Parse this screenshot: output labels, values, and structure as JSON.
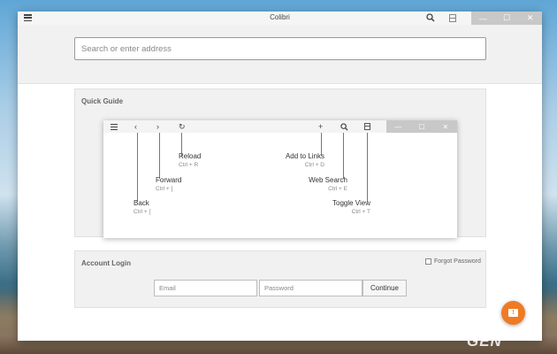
{
  "window": {
    "title": "Colibri",
    "controls": {
      "minimize": "—",
      "maximize": "☐",
      "close": "✕"
    }
  },
  "address_bar": {
    "placeholder": "Search or enter address"
  },
  "quick_guide": {
    "title": "Quick Guide",
    "items": [
      {
        "label": "Back",
        "shortcut": "Ctrl + ["
      },
      {
        "label": "Forward",
        "shortcut": "Ctrl + ]"
      },
      {
        "label": "Reload",
        "shortcut": "Ctrl + R"
      },
      {
        "label": "Add to Links",
        "shortcut": "Ctrl + D"
      },
      {
        "label": "Web Search",
        "shortcut": "Ctrl + E"
      },
      {
        "label": "Toggle View",
        "shortcut": "Ctrl + T"
      }
    ],
    "mini_icons": {
      "back": "‹",
      "forward": "›",
      "reload": "↻",
      "add": "+",
      "search": "⌕"
    }
  },
  "account_login": {
    "title": "Account Login",
    "forgot_label": "Forgot Password",
    "email_placeholder": "Email",
    "password_placeholder": "Password",
    "continue_label": "Continue"
  },
  "fab": {
    "glyph": "!"
  },
  "watermark": "GEN",
  "colors": {
    "accent": "#f07a23",
    "window_controls": "#c8c8c8",
    "panel_bg": "#f1f1f1"
  }
}
